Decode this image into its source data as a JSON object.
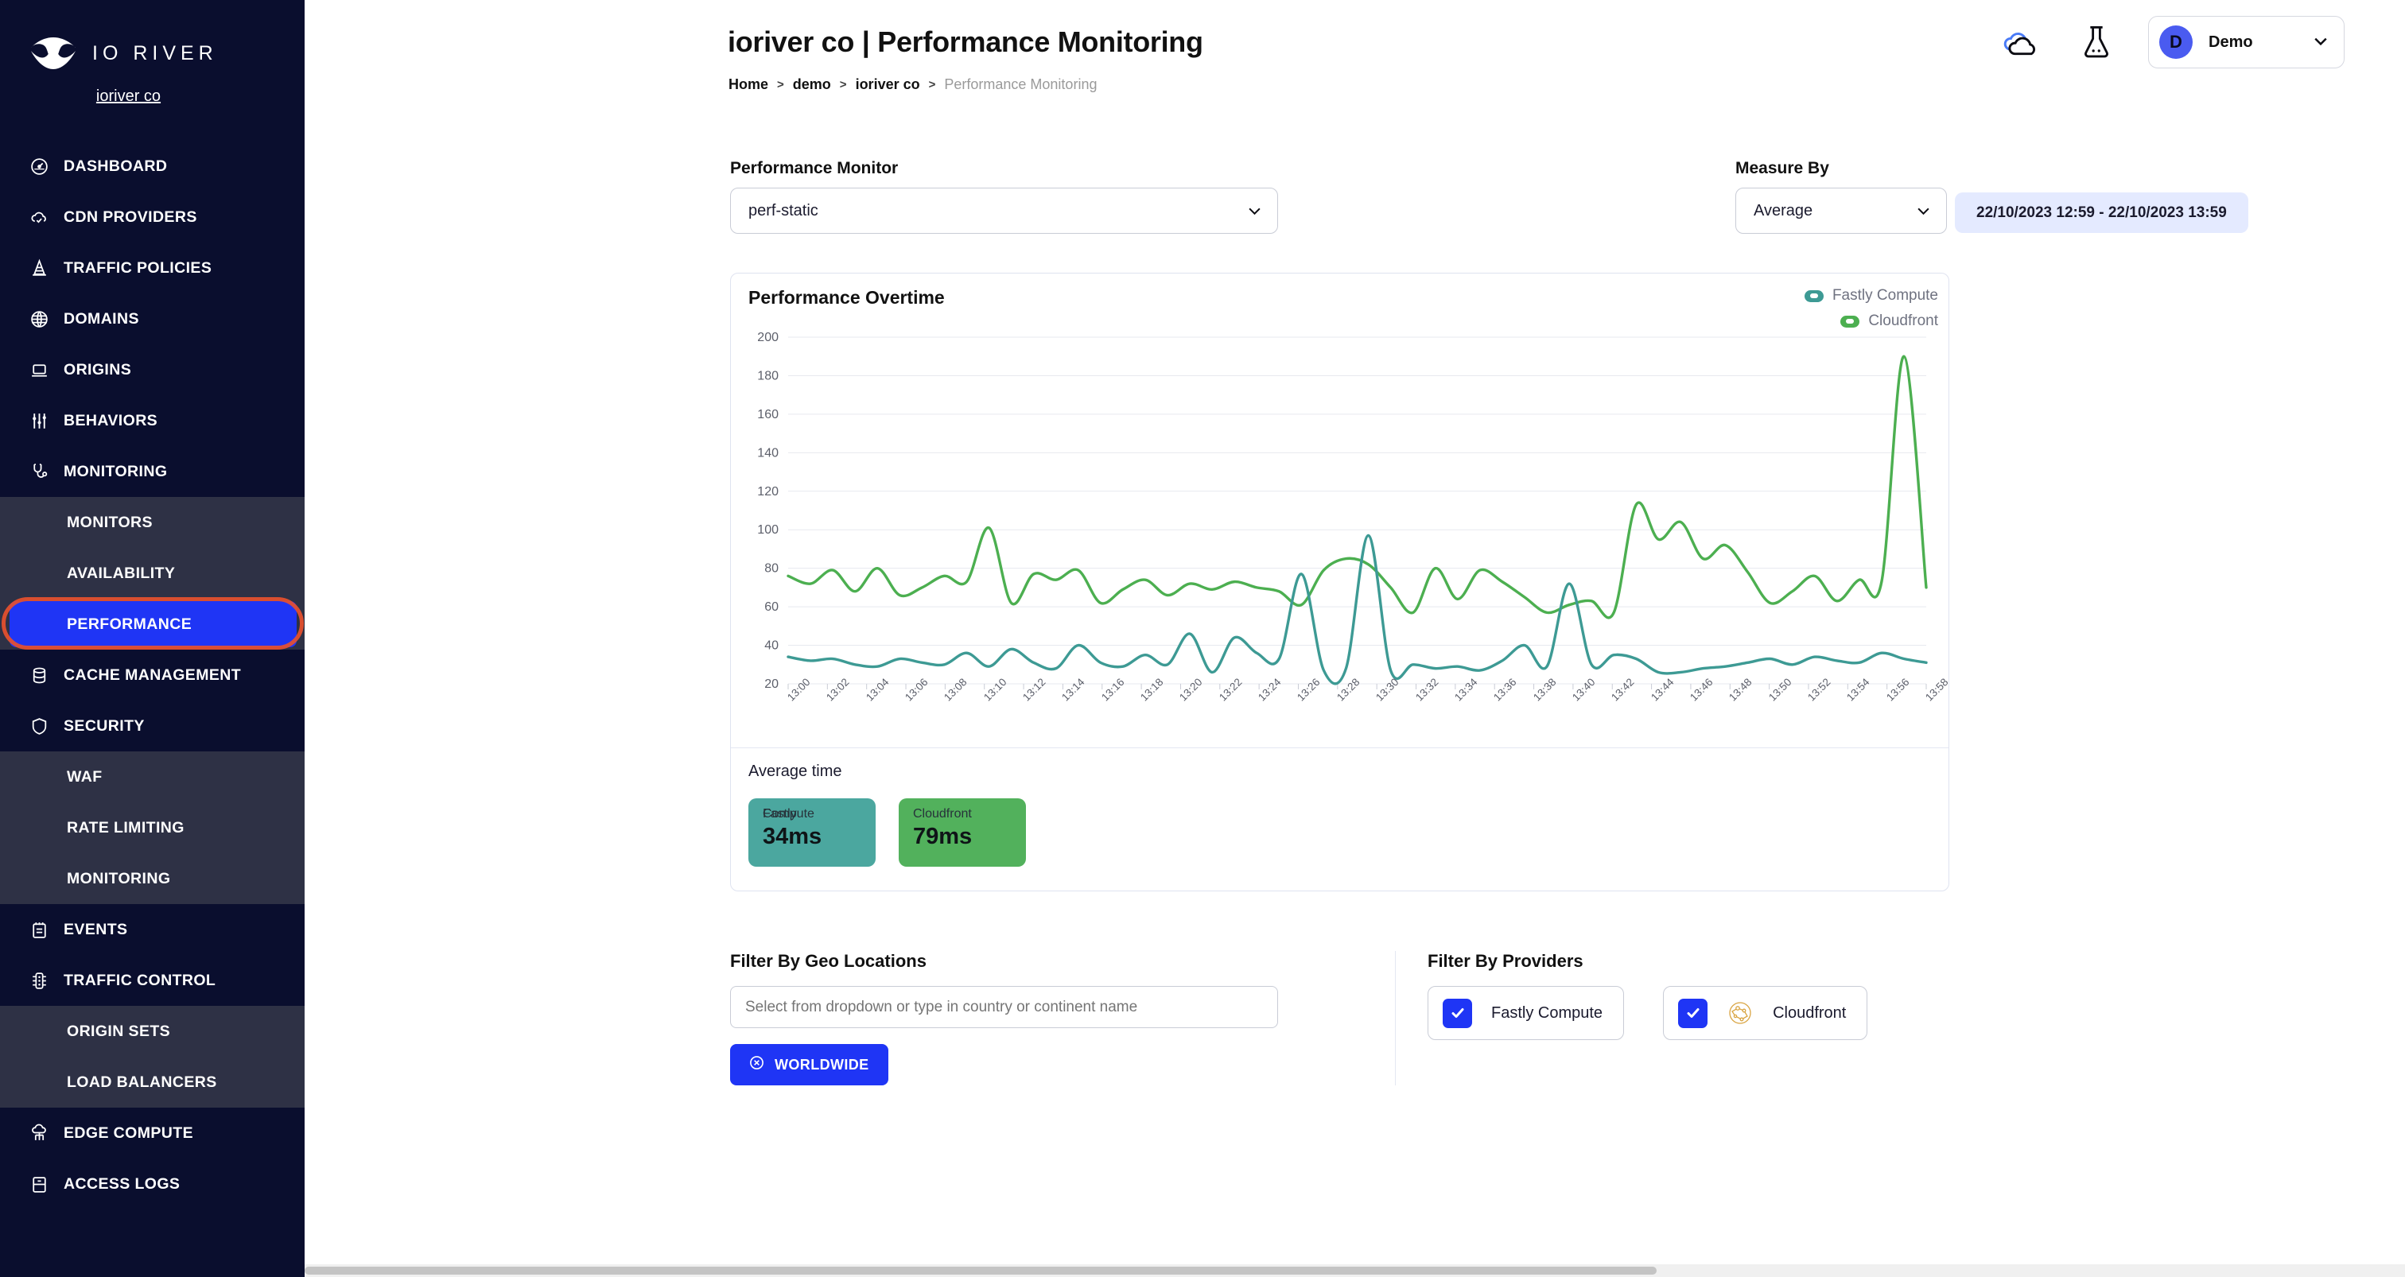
{
  "brand": {
    "name": "IO RIVER",
    "org_link": "ioriver co"
  },
  "sidebar": {
    "items": [
      {
        "label": "DASHBOARD",
        "icon": "dashboard-icon",
        "type": "main"
      },
      {
        "label": "CDN PROVIDERS",
        "icon": "cloud-check-icon",
        "type": "main"
      },
      {
        "label": "TRAFFIC POLICIES",
        "icon": "traffic-cone-icon",
        "type": "main"
      },
      {
        "label": "DOMAINS",
        "icon": "globe-icon",
        "type": "main"
      },
      {
        "label": "ORIGINS",
        "icon": "server-icon",
        "type": "main"
      },
      {
        "label": "BEHAVIORS",
        "icon": "sliders-icon",
        "type": "main"
      },
      {
        "label": "MONITORING",
        "icon": "stethoscope-icon",
        "type": "main"
      },
      {
        "label": "MONITORS",
        "type": "sub"
      },
      {
        "label": "AVAILABILITY",
        "type": "sub"
      },
      {
        "label": "PERFORMANCE",
        "type": "sub",
        "active": true
      },
      {
        "label": "CACHE MANAGEMENT",
        "icon": "database-icon",
        "type": "main"
      },
      {
        "label": "SECURITY",
        "icon": "shield-icon",
        "type": "main"
      },
      {
        "label": "WAF",
        "type": "sub"
      },
      {
        "label": "RATE LIMITING",
        "type": "sub"
      },
      {
        "label": "MONITORING",
        "type": "sub"
      },
      {
        "label": "EVENTS",
        "icon": "notepad-icon",
        "type": "main"
      },
      {
        "label": "TRAFFIC CONTROL",
        "icon": "traffic-light-icon",
        "type": "main"
      },
      {
        "label": "ORIGIN SETS",
        "type": "sub"
      },
      {
        "label": "LOAD BALANCERS",
        "type": "sub"
      },
      {
        "label": "EDGE COMPUTE",
        "icon": "edge-compute-icon",
        "type": "main"
      },
      {
        "label": "ACCESS LOGS",
        "icon": "logs-icon",
        "type": "main"
      }
    ]
  },
  "header": {
    "title": "ioriver co | Performance Monitoring",
    "breadcrumb": [
      "Home",
      "demo",
      "ioriver co",
      "Performance Monitoring"
    ],
    "icons": [
      "cloud-icon",
      "flask-icon"
    ],
    "account": {
      "initial": "D",
      "name": "Demo",
      "chevron": "chevron-down-icon"
    }
  },
  "filters": {
    "monitor": {
      "label": "Performance Monitor",
      "value": "perf-static"
    },
    "measure": {
      "label": "Measure By",
      "value": "Average"
    },
    "date_range": "22/10/2023 12:59 - 22/10/2023 13:59"
  },
  "chart_card": {
    "title": "Performance Overtime",
    "legend": [
      {
        "name": "Fastly Compute",
        "color": "#3d9a94"
      },
      {
        "name": "Cloudfront",
        "color": "#4caf50"
      }
    ],
    "average": {
      "label": "Average time",
      "cards": [
        {
          "name": "Fastly",
          "name2": "Compute",
          "value": "34ms",
          "color": "#4ba79f"
        },
        {
          "name": "Cloudfront",
          "value": "79ms",
          "color": "#52b15c"
        }
      ]
    }
  },
  "chart_data": {
    "type": "line",
    "title": "Performance Overtime",
    "xlabel": "",
    "ylabel": "",
    "ylim": [
      20,
      200
    ],
    "yticks": [
      20,
      40,
      60,
      80,
      100,
      120,
      140,
      160,
      180,
      200
    ],
    "grid": true,
    "legend_position": "top-right",
    "x": [
      "13:00",
      "13:02",
      "13:04",
      "13:06",
      "13:08",
      "13:10",
      "13:12",
      "13:14",
      "13:16",
      "13:18",
      "13:20",
      "13:22",
      "13:24",
      "13:26",
      "13:28",
      "13:30",
      "13:32",
      "13:34",
      "13:36",
      "13:38",
      "13:40",
      "13:42",
      "13:44",
      "13:46",
      "13:48",
      "13:50",
      "13:52",
      "13:54",
      "13:56",
      "13:58"
    ],
    "series": [
      {
        "name": "Cloudfront",
        "color": "#4caf50",
        "values": [
          76,
          72,
          79,
          68,
          80,
          66,
          70,
          76,
          73,
          101,
          62,
          77,
          74,
          79,
          62,
          69,
          74,
          66,
          72,
          69,
          73,
          70,
          68,
          61,
          79,
          85,
          82,
          70,
          57,
          80,
          64,
          79,
          73,
          65,
          57,
          61,
          63,
          57,
          113,
          95,
          104,
          85,
          92,
          78,
          62,
          68,
          76,
          63,
          74,
          73,
          190,
          70
        ]
      },
      {
        "name": "Fastly Compute",
        "color": "#3d9a94",
        "values": [
          34,
          32,
          33,
          30,
          29,
          33,
          31,
          30,
          36,
          29,
          38,
          31,
          28,
          40,
          31,
          29,
          35,
          30,
          46,
          26,
          44,
          36,
          33,
          77,
          27,
          28,
          97,
          27,
          30,
          28,
          29,
          27,
          32,
          40,
          29,
          72,
          30,
          35,
          33,
          26,
          26,
          28,
          29,
          31,
          33,
          30,
          34,
          32,
          31,
          36,
          33,
          31
        ]
      }
    ]
  },
  "geo_filter": {
    "title": "Filter By Geo Locations",
    "placeholder": "Select from dropdown or type in country or continent name",
    "chip": {
      "label": "WORLDWIDE",
      "icon": "remove-circle-icon"
    }
  },
  "provider_filter": {
    "title": "Filter By Providers",
    "providers": [
      {
        "label": "Fastly Compute",
        "checked": true,
        "icon": null
      },
      {
        "label": "Cloudfront",
        "checked": true,
        "icon": "cloudfront-icon"
      }
    ]
  },
  "colors": {
    "sidebar_bg": "#0a0e2e",
    "subnav_bg": "#2e3145",
    "accent_blue": "#1f35f5",
    "annotation_red": "#e8502e",
    "fastly_teal": "#3d9a94",
    "cloudfront_green": "#4caf50",
    "daterange_bg": "#e4eaff"
  }
}
